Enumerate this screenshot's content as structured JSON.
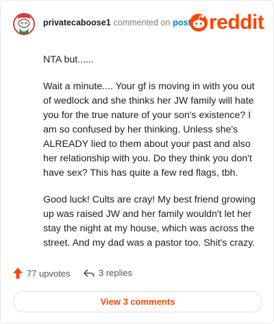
{
  "header": {
    "username": "privatecaboose1",
    "commented_on": "commented on",
    "post_link": "post",
    "logo_text": "reddit"
  },
  "comment": {
    "paragraphs": [
      "NTA but......",
      "Wait a minute.... Your gf is moving in with you out of wedlock and she thinks her JW family will hate you for the true nature of your son's existence? I am so confused by her thinking. Unless she's ALREADY lied to them about your past and also her relationship with you. Do they think you don't have sex? This has quite a few red flags, tbh.",
      "Good luck! Cults are cray! My best friend growing up was raised JW and her family wouldn't let her stay the night at my house, which was across the street. And my dad was a pastor too. Shit's crazy."
    ]
  },
  "actions": {
    "upvotes": "77 upvotes",
    "replies": "3 replies"
  },
  "view_comments_label": "View 3 comments",
  "colors": {
    "brand": "#ff4500",
    "link": "#0079d3"
  },
  "icons": {
    "avatar": "snoo-avatar-icon",
    "logo": "reddit-logo-icon",
    "upvote": "upvote-arrow-icon",
    "reply": "reply-arrow-icon"
  }
}
